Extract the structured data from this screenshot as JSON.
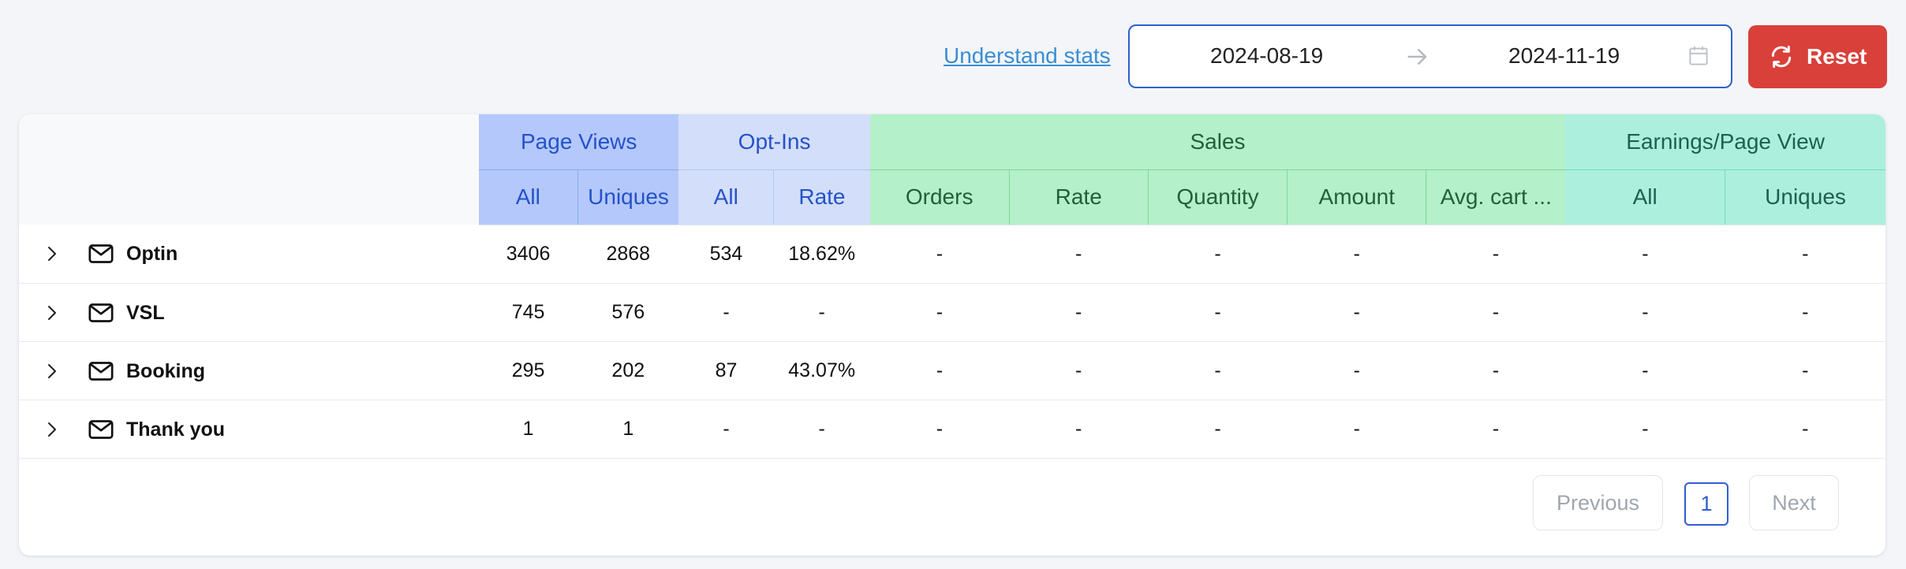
{
  "toolbar": {
    "understand_link": "Understand stats",
    "date_start": "2024-08-19",
    "date_end": "2024-11-19",
    "reset_label": "Reset"
  },
  "table": {
    "group_headers": {
      "page_views": "Page Views",
      "opt_ins": "Opt-Ins",
      "sales": "Sales",
      "earnings": "Earnings/Page View"
    },
    "sub_headers": {
      "pv_all": "All",
      "pv_uniques": "Uniques",
      "oi_all": "All",
      "oi_rate": "Rate",
      "sa_orders": "Orders",
      "sa_rate": "Rate",
      "sa_quantity": "Quantity",
      "sa_amount": "Amount",
      "sa_avg_cart": "Avg. cart ...",
      "ea_all": "All",
      "ea_uniques": "Uniques"
    },
    "rows": [
      {
        "name": "Optin",
        "cells": [
          "3406",
          "2868",
          "534",
          "18.62%",
          "-",
          "-",
          "-",
          "-",
          "-",
          "-",
          "-"
        ]
      },
      {
        "name": "VSL",
        "cells": [
          "745",
          "576",
          "-",
          "-",
          "-",
          "-",
          "-",
          "-",
          "-",
          "-",
          "-"
        ]
      },
      {
        "name": "Booking",
        "cells": [
          "295",
          "202",
          "87",
          "43.07%",
          "-",
          "-",
          "-",
          "-",
          "-",
          "-",
          "-"
        ]
      },
      {
        "name": "Thank you",
        "cells": [
          "1",
          "1",
          "-",
          "-",
          "-",
          "-",
          "-",
          "-",
          "-",
          "-",
          "-"
        ]
      }
    ]
  },
  "pagination": {
    "previous": "Previous",
    "current_page": "1",
    "next": "Next"
  },
  "colors": {
    "primary_blue": "#2f5fd0",
    "reset_red": "#d9403a",
    "page_views_bg": "#b4c8fb",
    "opt_ins_bg": "#d3defa",
    "sales_bg": "#b4f0c9",
    "earnings_bg": "#abefdc"
  }
}
